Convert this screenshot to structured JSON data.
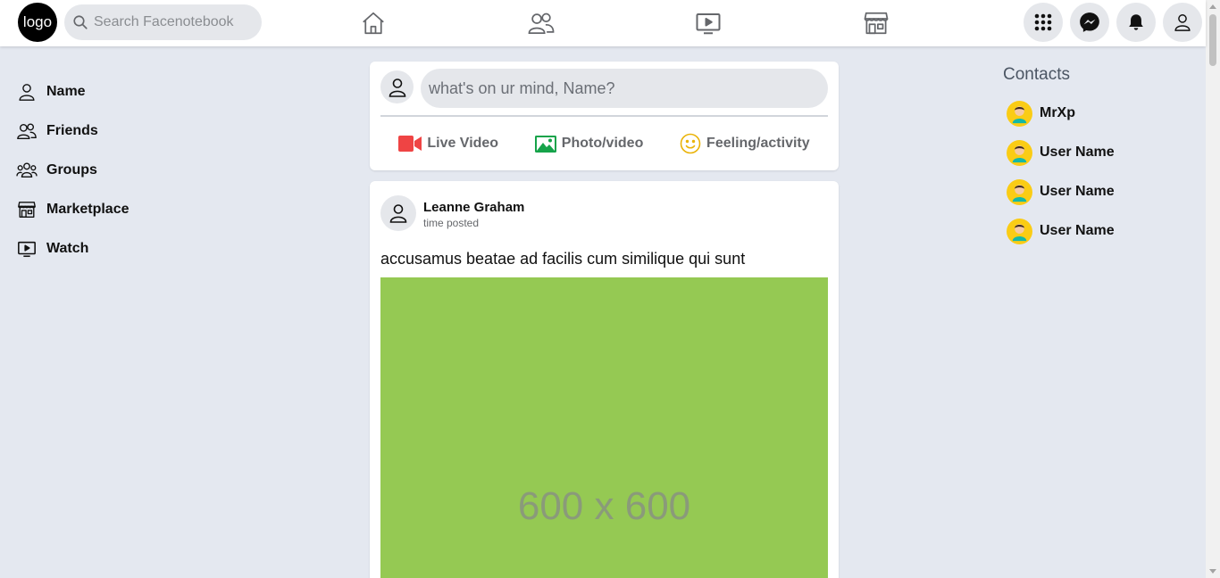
{
  "header": {
    "logo_text": "logo",
    "search_placeholder": "Search Facenotebook",
    "nav_icons": [
      "home-icon",
      "friends-icon",
      "watch-icon",
      "marketplace-icon"
    ],
    "action_icons": [
      "menu-grid-icon",
      "messenger-icon",
      "bell-icon",
      "profile-icon"
    ]
  },
  "sidebar": {
    "items": [
      {
        "label": "Name",
        "icon": "user-icon"
      },
      {
        "label": "Friends",
        "icon": "friends-icon"
      },
      {
        "label": "Groups",
        "icon": "groups-icon"
      },
      {
        "label": "Marketplace",
        "icon": "marketplace-icon"
      },
      {
        "label": "Watch",
        "icon": "watch-icon"
      }
    ]
  },
  "composer": {
    "placeholder": "what's on ur mind, Name?",
    "actions": [
      {
        "label": "Live Video",
        "icon": "video-camera-icon",
        "color": "#ef4444"
      },
      {
        "label": "Photo/video",
        "icon": "image-icon",
        "color": "#16a34a"
      },
      {
        "label": "Feeling/activity",
        "icon": "smiley-icon",
        "color": "#eab308"
      }
    ]
  },
  "post": {
    "author": "Leanne Graham",
    "time": "time posted",
    "text": "accusamus beatae ad facilis cum similique qui sunt",
    "image_placeholder": "600 x 600",
    "image_color": "#95c953"
  },
  "contacts": {
    "title": "Contacts",
    "items": [
      {
        "name": "MrXp"
      },
      {
        "name": "User Name"
      },
      {
        "name": "User Name"
      },
      {
        "name": "User Name"
      }
    ]
  },
  "colors": {
    "background": "#e4e8f0",
    "card": "#ffffff",
    "icon_stroke": "#65676b"
  }
}
